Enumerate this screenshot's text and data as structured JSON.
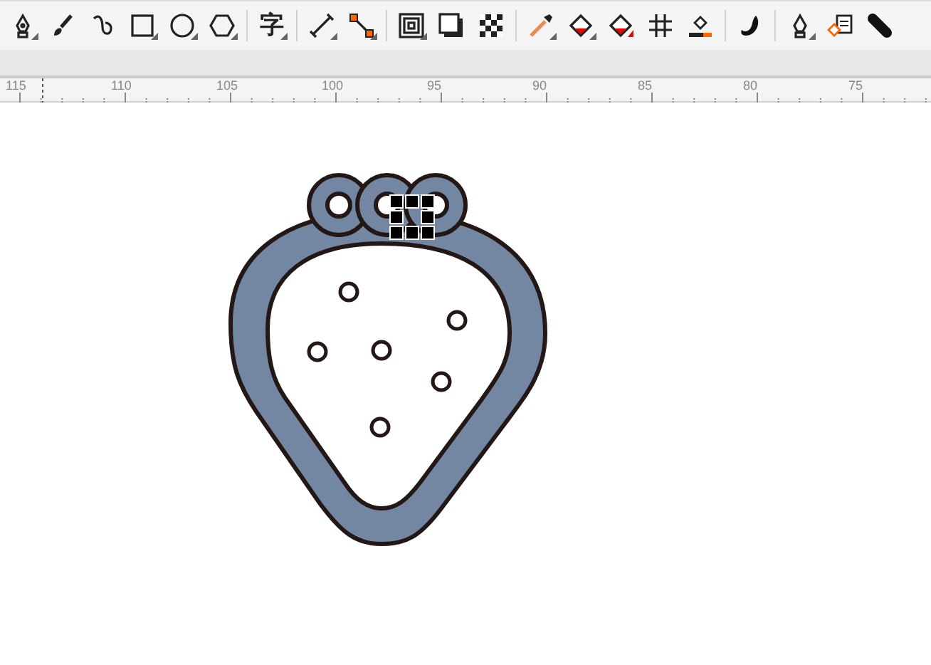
{
  "toolbar": {
    "tools": [
      {
        "flyout": true
      },
      {
        "flyout": false
      },
      {
        "flyout": false
      },
      {
        "flyout": true
      },
      {
        "flyout": true
      },
      {
        "flyout": true
      },
      {
        "flyout": true,
        "label": "字"
      },
      {
        "flyout": true
      },
      {
        "flyout": true
      },
      {
        "flyout": true
      },
      {
        "flyout": false
      },
      {
        "flyout": false
      },
      {
        "flyout": true
      },
      {
        "flyout": true
      },
      {
        "flyout": false
      },
      {
        "flyout": false
      },
      {
        "flyout": false
      },
      {
        "flyout": false
      },
      {
        "flyout": true
      },
      {
        "flyout": false
      },
      {
        "flyout": false
      }
    ]
  },
  "ruler": {
    "labels": [
      "115",
      "110",
      "105",
      "100",
      "95",
      "90",
      "85",
      "80",
      "75"
    ]
  }
}
